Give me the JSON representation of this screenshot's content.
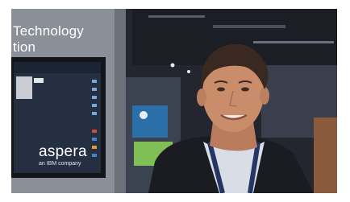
{
  "photo": {
    "subject": "man",
    "booth_sign_text": "Technology\ntion",
    "monitor_logo": "aspera",
    "monitor_logo_tagline": "an IBM company",
    "colors": {
      "booth_wall": "#8a8f96",
      "monitor_bezel": "#15171c",
      "monitor_screen": "#26313f",
      "jacket": "#1b1c20",
      "shirt": "#d8dce6",
      "skin": "#c98d6c",
      "hair": "#3b2a22",
      "lanyard": "#2b3a6b",
      "ceiling": "#2a2d36"
    }
  }
}
